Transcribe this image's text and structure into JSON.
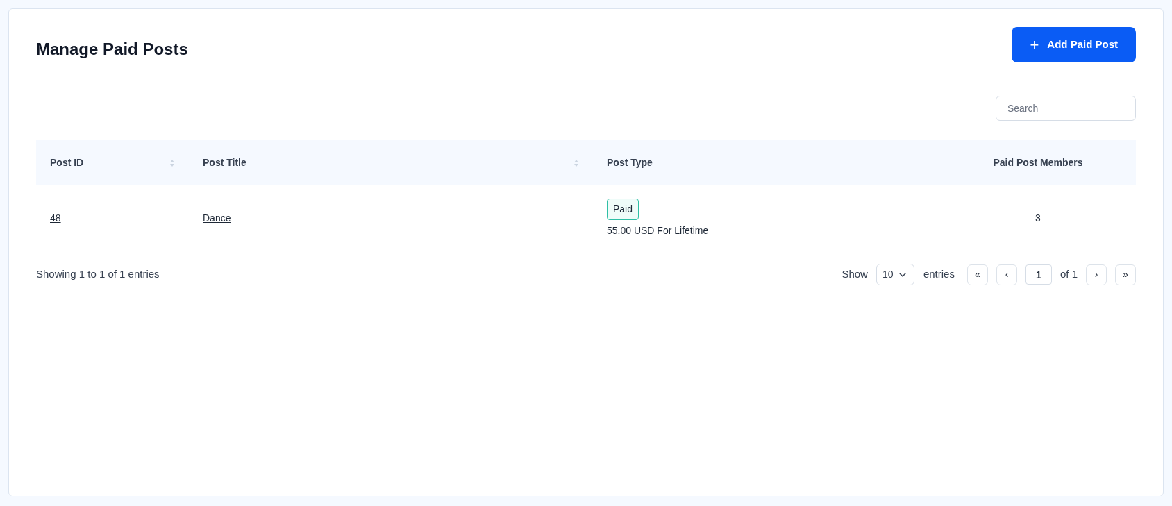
{
  "page": {
    "title": "Manage Paid Posts",
    "add_button": {
      "icon": "+",
      "label": "Add Paid Post"
    }
  },
  "search": {
    "placeholder": "Search"
  },
  "table": {
    "columns": [
      {
        "label": "Post ID",
        "sortable": true
      },
      {
        "label": "Post Title",
        "sortable": true
      },
      {
        "label": "Post Type",
        "sortable": false
      },
      {
        "label": "Paid Post Members",
        "sortable": false
      }
    ],
    "rows": [
      {
        "post_id": "48",
        "post_title": "Dance",
        "post_type": {
          "badge": "Paid",
          "price": "55.00 USD For Lifetime"
        },
        "members": "3"
      }
    ]
  },
  "footer": {
    "summary": "Showing 1 to 1 of 1 entries",
    "show_label": "Show",
    "page_size": "10",
    "entries_label": "entries",
    "first": "«",
    "prev": "‹",
    "page": "1",
    "of_label": "of 1",
    "next": "›",
    "last": "»"
  }
}
